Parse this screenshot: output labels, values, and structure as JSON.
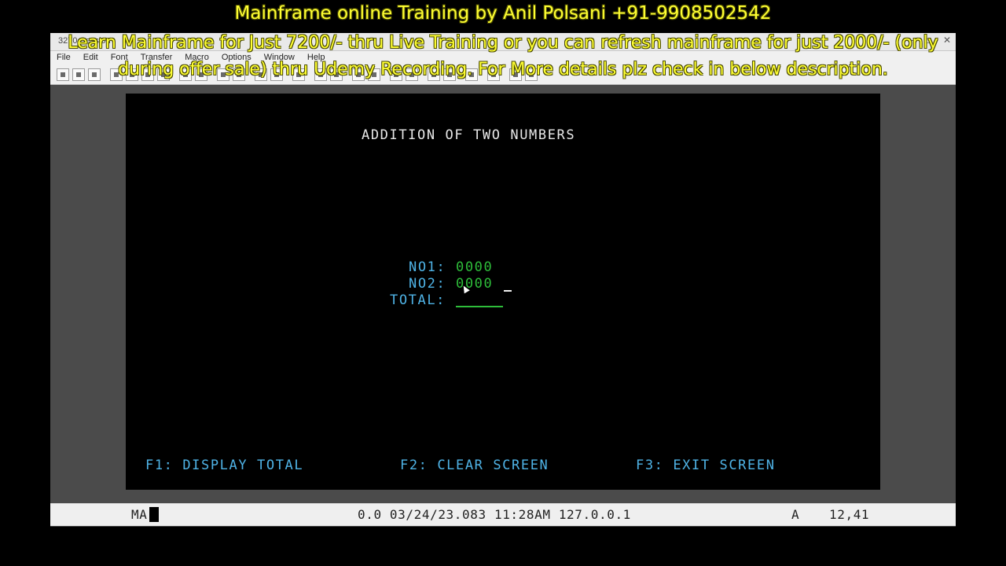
{
  "window": {
    "title": "3270 Session",
    "controls": [
      "—",
      "▫",
      "✕"
    ]
  },
  "menubar": {
    "items": [
      "File",
      "Edit",
      "Font",
      "Transfer",
      "Macro",
      "Options",
      "Window",
      "Help"
    ]
  },
  "overlay": {
    "line1": "Mainframe online Training by Anil Polsani +91-9908502542",
    "line2": "Learn Mainframe for Just 7200/- thru Live Training or you can refresh mainframe for just 2000/- (only during offer sale) thru Udemy Recording.  For More details plz check in below description."
  },
  "screen": {
    "title": "ADDITION OF TWO NUMBERS",
    "fields": {
      "no1_label": "NO1:",
      "no1_value": "0000",
      "no2_label": "NO2:",
      "no2_value": "0000",
      "total_label": "TOTAL:",
      "total_value": ""
    },
    "function_keys": {
      "f1": "F1: DISPLAY TOTAL",
      "f2": "F2: CLEAR SCREEN",
      "f3": "F3: EXIT SCREEN"
    }
  },
  "statusbar": {
    "mode": "MA",
    "info": "0.0 03/24/23.083 11:28AM 127.0.0.1",
    "flag": "A",
    "cursor_position": "12,41"
  },
  "colors": {
    "label": "#4fb3e6",
    "field_value": "#2ebd3a",
    "title_text": "#e8e8e8",
    "overlay_text": "#ffff33",
    "terminal_bg": "#000000"
  }
}
